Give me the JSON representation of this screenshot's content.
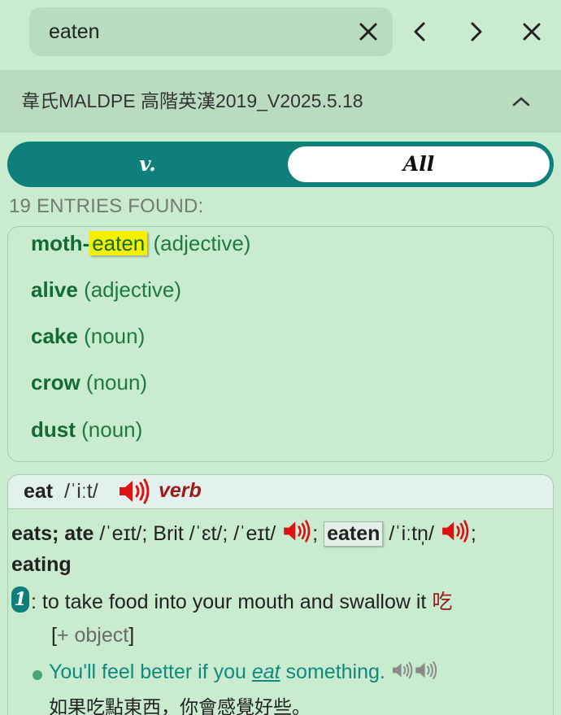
{
  "search": {
    "value": "eaten"
  },
  "header": {
    "dictionary_title": "韋氏MALDPE 高階英漢2019_V2025.5.18"
  },
  "toggle": {
    "left_label": "v.",
    "right_label": "All"
  },
  "entries": {
    "count_label": "19 ENTRIES FOUND:",
    "items": [
      {
        "word_prefix": "moth-",
        "word_highlight": "eaten",
        "pos": "(adjective)"
      },
      {
        "word": "alive",
        "pos": "(adjective)"
      },
      {
        "word": "cake",
        "pos": "(noun)"
      },
      {
        "word": "crow",
        "pos": "(noun)"
      },
      {
        "word": "dust",
        "pos": "(noun)"
      }
    ]
  },
  "definition": {
    "headword": "eat",
    "pronunciation": "/ˈiːt/",
    "pos": "verb",
    "forms": {
      "f1": "eats; ate",
      "f1_pron": "/ˈeɪt/; Brit /ˈɛt/; /ˈeɪt/",
      "sep1": ";",
      "f2": "eaten",
      "f2_pron": "/ˈiːtn̩/",
      "sep2": ";",
      "f3": "eating"
    },
    "sense": {
      "number": "1",
      "text": ": to take food into your mouth and swallow it",
      "zh": "吃",
      "grammar_open": "[",
      "grammar": "+ object",
      "grammar_close": "]",
      "example_before": "You'll feel better if you ",
      "example_em": "eat",
      "example_after": " something.",
      "example_zh": "如果吃點東西，你會感覺好些。"
    }
  },
  "colors": {
    "background": "#c9ebcf",
    "teal_accent": "#0e7f7b",
    "headword_green": "#136b33",
    "pos_red": "#9b1a1a",
    "highlight_yellow": "#f6f000"
  }
}
